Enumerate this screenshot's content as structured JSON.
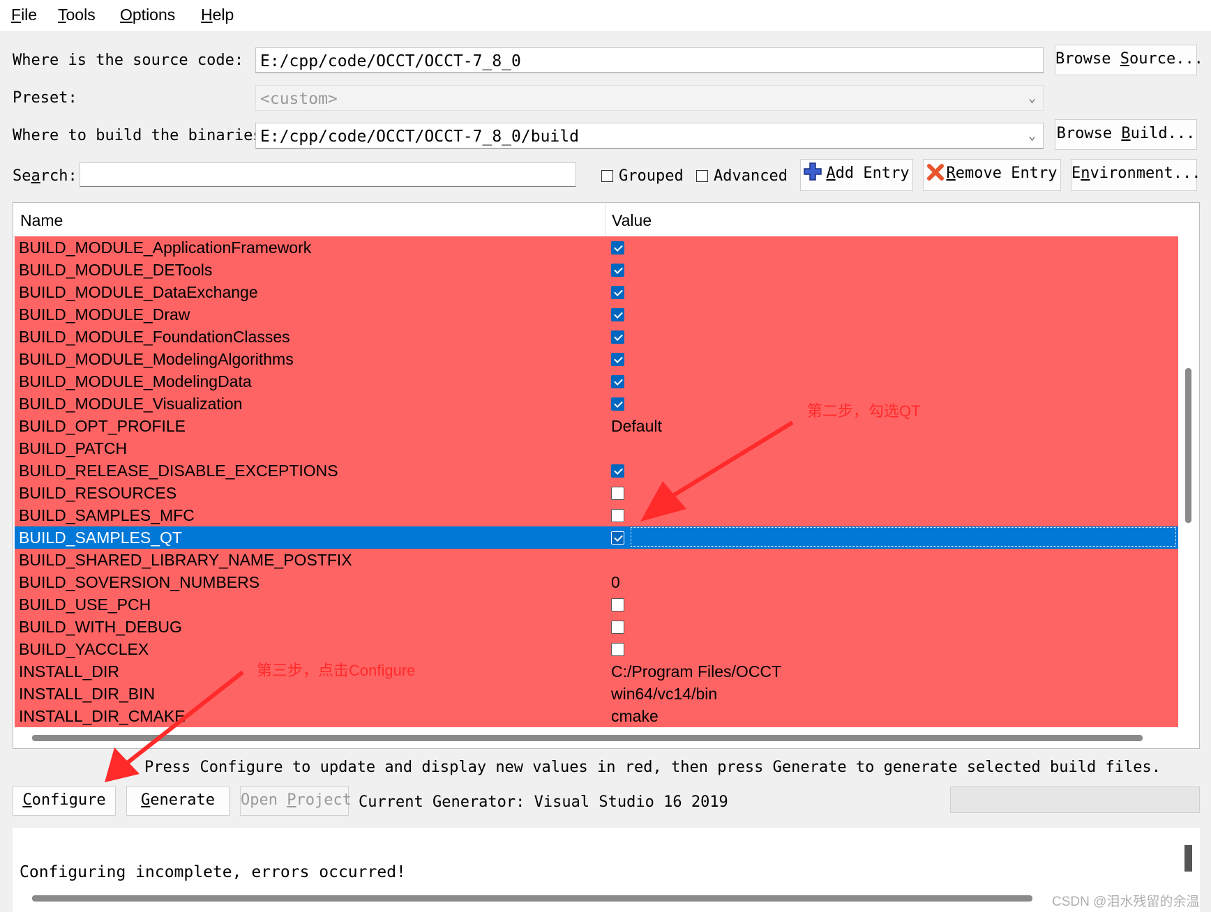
{
  "menu": [
    {
      "accel": "F",
      "rest": "ile"
    },
    {
      "accel": "T",
      "rest": "ools"
    },
    {
      "accel": "O",
      "rest": "ptions"
    },
    {
      "accel": "H",
      "rest": "elp"
    }
  ],
  "source": {
    "label": "Where is the source code:",
    "value": "E:/cpp/code/OCCT/OCCT-7_8_0",
    "browse_pre": "Browse ",
    "browse_accel": "S",
    "browse_post": "ource..."
  },
  "preset": {
    "label": "Preset:",
    "value": "<custom>"
  },
  "build": {
    "label": "Where to build the binaries:",
    "value": "E:/cpp/code/OCCT/OCCT-7_8_0/build",
    "browse_pre": "Browse ",
    "browse_accel": "B",
    "browse_post": "uild..."
  },
  "search": {
    "label_accel": "a",
    "label_pre": "Se",
    "label_post": "rch:",
    "value": ""
  },
  "toolbar": {
    "grouped": "Grouped",
    "advanced": "Advanced",
    "add_accel": "A",
    "add_rest": "dd Entry",
    "remove_accel": "R",
    "remove_rest": "emove Entry",
    "env_pre": "E",
    "env_accel": "n",
    "env_post": "vironment..."
  },
  "table": {
    "headers": [
      "Name",
      "Value"
    ],
    "rows": [
      {
        "name": "BUILD_MODULE_ApplicationFramework",
        "type": "bool",
        "checked": true
      },
      {
        "name": "BUILD_MODULE_DETools",
        "type": "bool",
        "checked": true
      },
      {
        "name": "BUILD_MODULE_DataExchange",
        "type": "bool",
        "checked": true
      },
      {
        "name": "BUILD_MODULE_Draw",
        "type": "bool",
        "checked": true
      },
      {
        "name": "BUILD_MODULE_FoundationClasses",
        "type": "bool",
        "checked": true
      },
      {
        "name": "BUILD_MODULE_ModelingAlgorithms",
        "type": "bool",
        "checked": true
      },
      {
        "name": "BUILD_MODULE_ModelingData",
        "type": "bool",
        "checked": true
      },
      {
        "name": "BUILD_MODULE_Visualization",
        "type": "bool",
        "checked": true
      },
      {
        "name": "BUILD_OPT_PROFILE",
        "type": "text",
        "value": "Default"
      },
      {
        "name": "BUILD_PATCH",
        "type": "text",
        "value": ""
      },
      {
        "name": "BUILD_RELEASE_DISABLE_EXCEPTIONS",
        "type": "bool",
        "checked": true
      },
      {
        "name": "BUILD_RESOURCES",
        "type": "bool",
        "checked": false
      },
      {
        "name": "BUILD_SAMPLES_MFC",
        "type": "bool",
        "checked": false
      },
      {
        "name": "BUILD_SAMPLES_QT",
        "type": "bool",
        "checked": true,
        "selected": true
      },
      {
        "name": "BUILD_SHARED_LIBRARY_NAME_POSTFIX",
        "type": "text",
        "value": ""
      },
      {
        "name": "BUILD_SOVERSION_NUMBERS",
        "type": "text",
        "value": "0"
      },
      {
        "name": "BUILD_USE_PCH",
        "type": "bool",
        "checked": false
      },
      {
        "name": "BUILD_WITH_DEBUG",
        "type": "bool",
        "checked": false
      },
      {
        "name": "BUILD_YACCLEX",
        "type": "bool",
        "checked": false
      },
      {
        "name": "INSTALL_DIR",
        "type": "text",
        "value": "C:/Program Files/OCCT"
      },
      {
        "name": "INSTALL_DIR_BIN",
        "type": "text",
        "value": "win64/vc14/bin"
      },
      {
        "name": "INSTALL_DIR_CMAKE",
        "type": "text",
        "value": "cmake"
      }
    ]
  },
  "hint": "Press Configure to update and display new values in red, then press Generate to generate selected build files.",
  "actions": {
    "configure_accel": "C",
    "configure_rest": "onfigure",
    "generate_accel": "G",
    "generate_rest": "enerate",
    "open_pre": "Open ",
    "open_accel": "P",
    "open_post": "roject",
    "generator": "Current Generator: Visual Studio 16 2019"
  },
  "output": "Configuring incomplete, errors occurred!",
  "annotations": {
    "step2": "第二步，勾选QT",
    "step3": "第三步，点击Configure"
  },
  "watermark": "CSDN @泪水残留的余温",
  "colors": {
    "changed_row": "#ff6464",
    "selected_row": "#0078d7",
    "annotation": "#ff2a2a"
  }
}
